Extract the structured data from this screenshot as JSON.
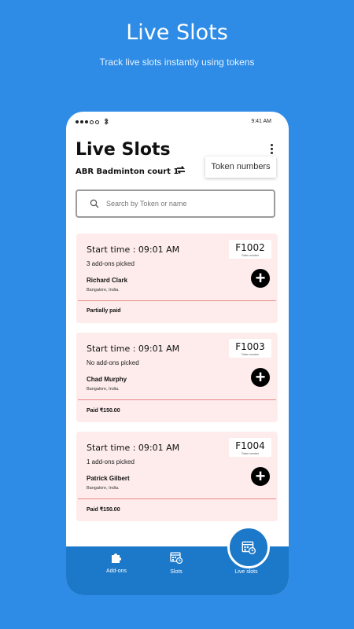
{
  "promo": {
    "title": "Live Slots",
    "subtitle": "Track live slots instantly using tokens"
  },
  "status_bar": {
    "time": "9:41 AM",
    "bluetooth": "bluetooth-icon"
  },
  "header": {
    "title": "Live Slots",
    "court": "ABR Badminton court 1",
    "tooltip": "Token numbers"
  },
  "search": {
    "placeholder": "Search by Token or name"
  },
  "cards": [
    {
      "start": "Start time : 09:01 AM",
      "addons": "3 add-ons picked",
      "name": "Richard Clark",
      "location": "Bangalore, India.",
      "payment": "Partially paid",
      "token": "F1002",
      "token_label": "Token number"
    },
    {
      "start": "Start time : 09:01 AM",
      "addons": "No add-ons picked",
      "name": "Chad Murphy",
      "location": "Bangalore, India.",
      "payment": "Paid ₹150.00",
      "token": "F1003",
      "token_label": "Token number"
    },
    {
      "start": "Start time : 09:01 AM",
      "addons": "1 add-ons picked",
      "name": "Patrick Gilbert",
      "location": "Bangalore, India.",
      "payment": "Paid ₹150.00",
      "token": "F1004",
      "token_label": "Token number"
    }
  ],
  "nav": {
    "addons": "Add-ons",
    "slots": "Slots",
    "live": "Live slots"
  },
  "colors": {
    "background": "#2e8ce6",
    "nav": "#1c78c8",
    "card": "#fdeceb",
    "divider": "#ea8a8a"
  }
}
